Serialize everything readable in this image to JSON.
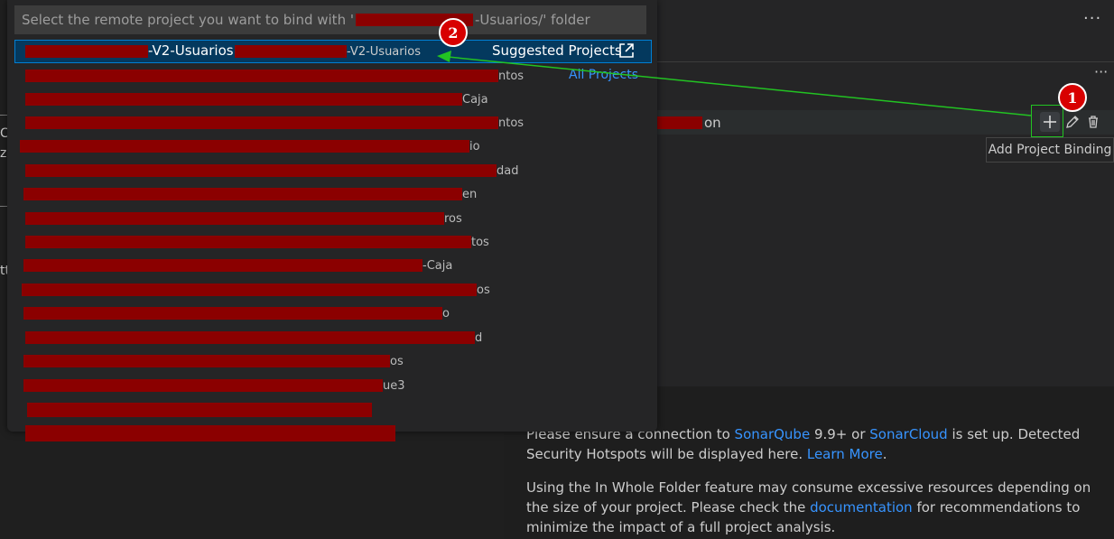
{
  "quick_pick": {
    "placeholder_prefix": "Select the remote project you want to bind with '",
    "placeholder_suffix": "-Usuarios/' folder",
    "selected_item": {
      "label_suffix": "-V2-Usuarios",
      "description_suffix": "-V2-Usuarios",
      "group_label": "Suggested Projects",
      "group_icon": "link-external-icon"
    },
    "all_projects_label": "All Projects",
    "item_suffixes": [
      "ntos",
      "Caja",
      "ntos",
      "io",
      "dad",
      "en",
      "ros",
      "tos",
      "-Caja",
      "os",
      "o",
      "d",
      "os",
      "ue3",
      "",
      ""
    ]
  },
  "side_panel": {
    "more_actions_icon": "ellipsis-icon",
    "binding_label_suffix": "on",
    "actions": {
      "add_icon": "plus-icon",
      "edit_icon": "pencil-icon",
      "delete_icon": "trash-icon"
    },
    "tooltip": "Add Project Binding"
  },
  "hotspots": {
    "p1_text_1": "Please ensure a connection to ",
    "p1_link_1": "SonarQube",
    "p1_text_2": " 9.9+ or ",
    "p1_link_2": "SonarCloud",
    "p1_text_3": " is set up. Detected Security Hotspots will be displayed here. ",
    "p1_link_3": "Learn More",
    "p1_text_4": ".",
    "p2_text_1": "Using the In Whole Folder feature may consume excessive resources depending on the size of your project. Please check the ",
    "p2_link_1": "documentation",
    "p2_text_2": " for recommendations to minimize the impact of a full project analysis."
  },
  "left_edge": {
    "frag1": "C",
    "frag2": "za",
    "frag3": "tt"
  },
  "annotations": {
    "badge1": "1",
    "badge2": "2",
    "arrow_color": "#22c322",
    "badge_color": "#d80000"
  }
}
